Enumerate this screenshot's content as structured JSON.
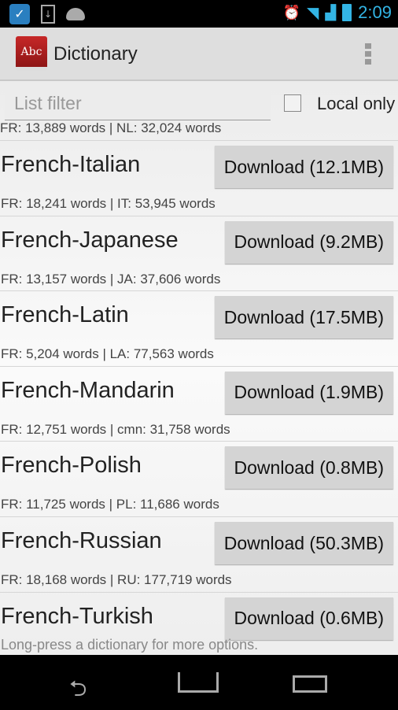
{
  "status": {
    "time": "2:09",
    "icons": [
      "security-app-icon",
      "download-icon",
      "android-icon",
      "alarm-icon",
      "wifi-icon",
      "signal-icon",
      "battery-charging-icon"
    ]
  },
  "appbar": {
    "title": "Dictionary",
    "logo_text": "Abc"
  },
  "filter": {
    "placeholder": "List filter",
    "value": "",
    "local_only_label": "Local only",
    "local_only_checked": false
  },
  "partial_row": {
    "words": "FR: 13,889 words | NL: 32,024 words"
  },
  "rows": [
    {
      "name": "French-Italian",
      "button": "Download (12.1MB)",
      "words": "FR: 18,241 words | IT: 53,945 words"
    },
    {
      "name": "French-Japanese",
      "button": "Download (9.2MB)",
      "words": "FR: 13,157 words | JA: 37,606 words"
    },
    {
      "name": "French-Latin",
      "button": "Download (17.5MB)",
      "words": "FR: 5,204 words | LA: 77,563 words"
    },
    {
      "name": "French-Mandarin",
      "button": "Download (1.9MB)",
      "words": "FR: 12,751 words | cmn: 31,758 words"
    },
    {
      "name": "French-Polish",
      "button": "Download (0.8MB)",
      "words": "FR: 11,725 words | PL: 11,686 words"
    },
    {
      "name": "French-Russian",
      "button": "Download (50.3MB)",
      "words": "FR: 18,168 words | RU: 177,719 words"
    },
    {
      "name": "French-Turkish",
      "button": "Download (0.6MB)",
      "words": ""
    }
  ],
  "hint": "Long-press a dictionary for more options.",
  "accent": "#33b5e5"
}
